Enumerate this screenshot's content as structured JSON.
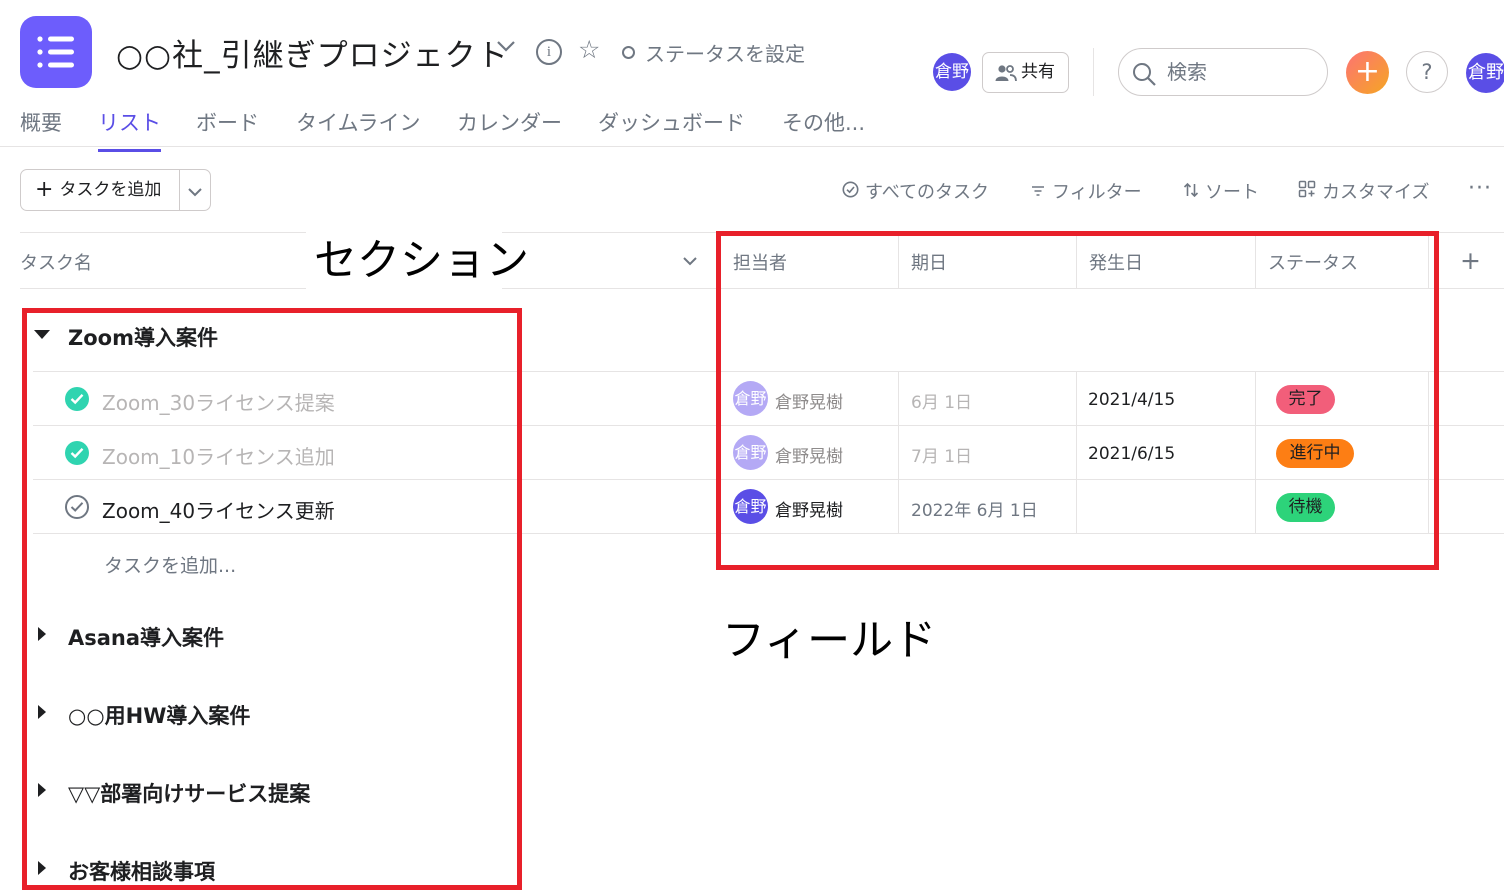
{
  "header": {
    "project_title": "○○社_引継ぎプロジェクト",
    "status_label": "ステータスを設定",
    "avatar_text": "倉野",
    "share_label": "共有",
    "search_placeholder": "検索",
    "help_label": "?",
    "user_avatar_text": "倉野"
  },
  "tabs": [
    {
      "label": "概要"
    },
    {
      "label": "リスト"
    },
    {
      "label": "ボード"
    },
    {
      "label": "タイムライン"
    },
    {
      "label": "カレンダー"
    },
    {
      "label": "ダッシュボード"
    },
    {
      "label": "その他..."
    }
  ],
  "toolbar": {
    "add_task_label": "タスクを追加",
    "all_tasks_label": "すべてのタスク",
    "filter_label": "フィルター",
    "sort_label": "ソート",
    "customize_label": "カスタマイズ",
    "more_label": "···"
  },
  "table": {
    "task_name_header": "タスク名",
    "columns": [
      "担当者",
      "期日",
      "発生日",
      "ステータス"
    ],
    "add_column_label": "+"
  },
  "sections": [
    {
      "title": "Zoom導入案件",
      "expanded": true,
      "tasks": [
        {
          "name": "Zoom_30ライセンス提案",
          "completed": true,
          "assignee_avatar": "倉野",
          "assignee": "倉野晃樹",
          "due": "6月 1日",
          "occurred": "2021/4/15",
          "status": "完了",
          "status_color": "#f25e7a"
        },
        {
          "name": "Zoom_10ライセンス追加",
          "completed": true,
          "assignee_avatar": "倉野",
          "assignee": "倉野晃樹",
          "due": "7月 1日",
          "occurred": "2021/6/15",
          "status": "進行中",
          "status_color": "#fd7e14"
        },
        {
          "name": "Zoom_40ライセンス更新",
          "completed": false,
          "assignee_avatar": "倉野",
          "assignee": "倉野晃樹",
          "due": "2022年 6月 1日",
          "occurred": "",
          "status": "待機",
          "status_color": "#2dd37a"
        }
      ],
      "add_task_label": "タスクを追加..."
    },
    {
      "title": "Asana導入案件",
      "expanded": false
    },
    {
      "title": "○○用HW導入案件",
      "expanded": false
    },
    {
      "title": "▽▽部署向けサービス提案",
      "expanded": false
    },
    {
      "title": "お客様相談事項",
      "expanded": false
    }
  ],
  "annotations": {
    "section_label": "セクション",
    "field_label": "フィールド",
    "box_color": "#e8202a"
  },
  "colors": {
    "accent": "#5a4ee6",
    "app_icon": "#6d5dfc",
    "check_done": "#2fd4b0"
  }
}
